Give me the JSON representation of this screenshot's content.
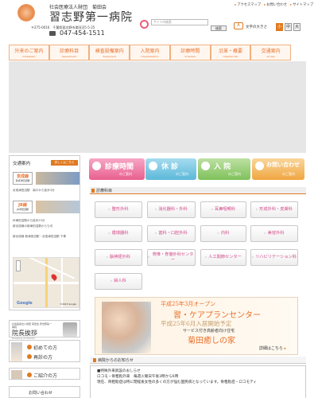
{
  "header": {
    "subtitle": "社会医療法人財団　菊田会",
    "hospital_name": "習志野第一病院",
    "address": "〒275-0016　千葉県習志野市津田沼5-5-25",
    "phone": "047-454-1511"
  },
  "top_links": [
    "アクセスマップ",
    "お問い合わせ",
    "サイトマップ"
  ],
  "search": {
    "placeholder": "サイト内検索",
    "button": "検索"
  },
  "font_size": {
    "icon": "A",
    "label": "文字の大きさ",
    "options": [
      "小",
      "中",
      "大"
    ],
    "selected": "小"
  },
  "nav": [
    {
      "jp": "外来のご案内",
      "en": "Outpatient"
    },
    {
      "jp": "診療科目",
      "en": "Department"
    },
    {
      "jp": "検査設備案内",
      "en": "Equipment"
    },
    {
      "jp": "入院案内",
      "en": "Hospitalization"
    },
    {
      "jp": "診療時間",
      "en": "Schedule"
    },
    {
      "jp": "沿革・概要",
      "en": "Hospital Info"
    },
    {
      "jp": "交通案内",
      "en": "Access"
    }
  ],
  "access": {
    "header": "交通案内",
    "tag": "詳しくはこちら",
    "keisei": {
      "badge": "京成線",
      "sub": "京成津田沼駅",
      "text": "京成津田沼駅　南口から徒歩3分"
    },
    "jr": {
      "badge": "JR線",
      "sub": "JR津田沼駅",
      "text1": "JR津田沼駅から徒歩15分",
      "text2": "新京成線の新津田沼駅からも可"
    },
    "bus_text": "新京成線 新津田沼駅・京成津田沼駅 下車"
  },
  "map": {
    "google": "Google",
    "copyright": "©2013 Google"
  },
  "director": {
    "small": "社会医療法人財団 菊田会 習志野第一病院",
    "big": "院長挨拶",
    "en": "Greeting of director"
  },
  "first_visit": {
    "line1": "初めての方",
    "line2": "再診の方"
  },
  "introduction": {
    "label": "ご紹介の方"
  },
  "left_last": {
    "label": "お問い合わせ"
  },
  "quick_links": [
    {
      "jp": "診療時間",
      "en": "のご案内"
    },
    {
      "jp": "休 診",
      "en": "のご案内"
    },
    {
      "jp": "入 院",
      "en": "のご案内"
    },
    {
      "jp": "お問い合わせ",
      "en": "のご案内"
    }
  ],
  "departments_section": {
    "title": "診療科目"
  },
  "departments": [
    "整形外科",
    "消化器科・外科",
    "耳鼻咽喉科",
    "形成外科・皮膚科",
    "循環器科",
    "歯科・口腔外科",
    "内科",
    "美容外科",
    "脳神経外科",
    "脊椎・脊髄外科センター",
    "人工関節センター",
    "リハビリテーション科",
    "婦人科"
  ],
  "banner": {
    "line1": "平成25年3月オープン",
    "line2": "習・ケアプランセンター",
    "line3": "平成25年6月入居開始予定",
    "line4": "サービス付き高齢者向け住宅",
    "line5": "菊田癒しの家",
    "more": "詳細はこちら"
  },
  "news": {
    "title": "病院からのお知らせ",
    "items": [
      "■特殊外来新設のおしらせ",
      "ロコモ・骨粗鬆外来　毎週火曜日午後3時から6時",
      "",
      "現在、骨粗鬆症は特に閉経後女性の多くの方が悩む国民病となっています。骨粗鬆症・ロコモティ"
    ]
  }
}
